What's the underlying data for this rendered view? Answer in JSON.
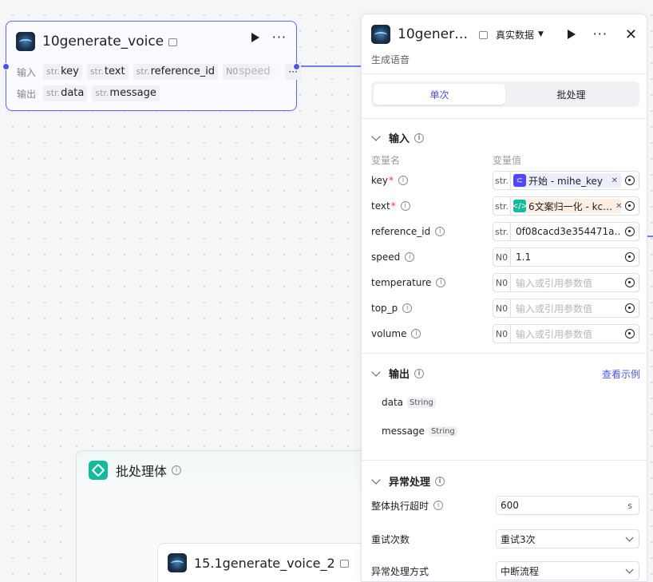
{
  "canvas": {
    "node": {
      "title": "10generate_voice",
      "input_label": "输入",
      "output_label": "输出",
      "inputs": [
        {
          "type": "str.",
          "name": "key"
        },
        {
          "type": "str.",
          "name": "text"
        },
        {
          "type": "str.",
          "name": "reference_id"
        },
        {
          "type": "N0",
          "name": "speed"
        }
      ],
      "more": "···",
      "outputs": [
        {
          "type": "str.",
          "name": "data"
        },
        {
          "type": "str.",
          "name": "message"
        }
      ]
    },
    "batch": {
      "title": "批处理体"
    },
    "node2": {
      "title": "15.1generate_voice_2"
    }
  },
  "panel": {
    "title": "10generate_voice",
    "mode_label": "真实数据",
    "description": "生成语音",
    "tabs": [
      "单次",
      "批处理"
    ],
    "active_tab": 0,
    "input_section": {
      "title": "输入",
      "col_name": "变量名",
      "col_value": "变量值",
      "rows": [
        {
          "name": "key",
          "required": true,
          "type": "str.",
          "kind": "ref",
          "chip_color": "purple",
          "chip_icon": "start-icon",
          "value": "开始 - mihe_key"
        },
        {
          "name": "text",
          "required": true,
          "type": "str.",
          "kind": "ref",
          "chip_color": "orange",
          "chip_icon": "code-icon",
          "value": "6文案归一化 - kc…"
        },
        {
          "name": "reference_id",
          "required": false,
          "type": "str.",
          "kind": "text",
          "value": "0f08cacd3e354471a…"
        },
        {
          "name": "speed",
          "required": false,
          "type": "N0",
          "kind": "text",
          "value": "1.1"
        },
        {
          "name": "temperature",
          "required": false,
          "type": "N0",
          "kind": "placeholder",
          "value": "输入或引用参数值"
        },
        {
          "name": "top_p",
          "required": false,
          "type": "N0",
          "kind": "placeholder",
          "value": "输入或引用参数值"
        },
        {
          "name": "volume",
          "required": false,
          "type": "N0",
          "kind": "placeholder",
          "value": "输入或引用参数值"
        }
      ]
    },
    "output_section": {
      "title": "输出",
      "link": "查看示例",
      "rows": [
        {
          "name": "data",
          "type": "String"
        },
        {
          "name": "message",
          "type": "String"
        }
      ]
    },
    "exception_section": {
      "title": "异常处理",
      "timeout_label": "整体执行超时",
      "timeout_value": "600",
      "timeout_unit": "s",
      "retry_label": "重试次数",
      "retry_value": "重试3次",
      "handling_label": "异常处理方式",
      "handling_value": "中断流程"
    }
  },
  "colors": {
    "accent": "#4d53e8",
    "node_border": "#6366f1",
    "required": "#f93920",
    "batch_icon": "#13bb9c"
  }
}
